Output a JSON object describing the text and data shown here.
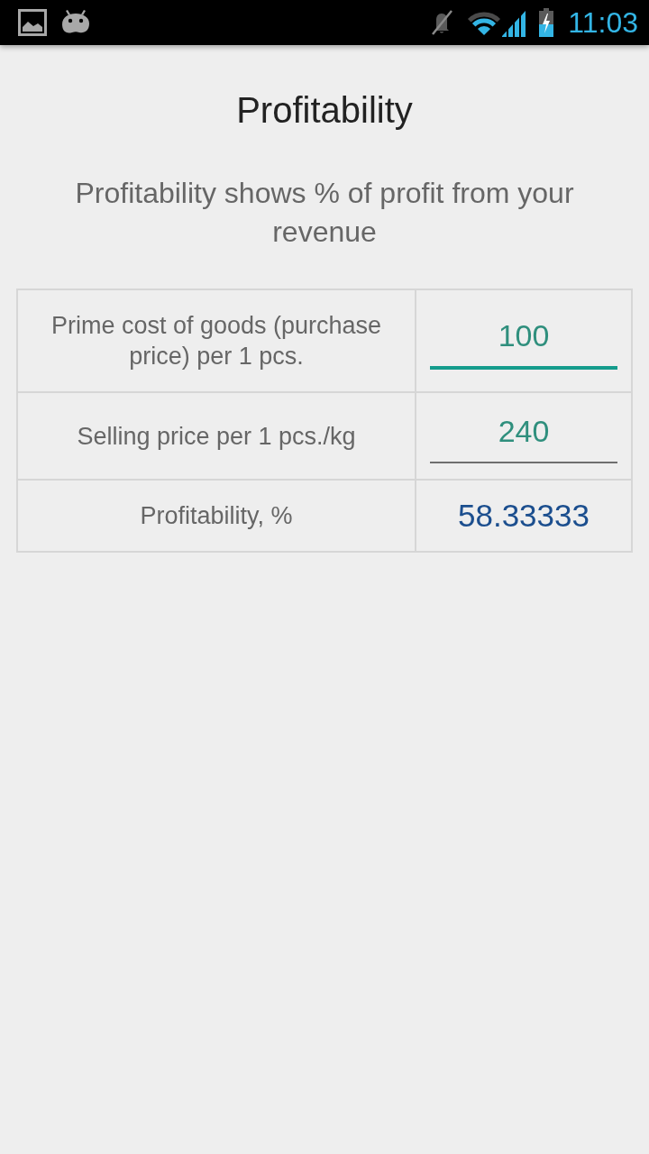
{
  "status_bar": {
    "time": "11:03"
  },
  "title": "Profitability",
  "subtitle": "Profitability shows % of profit from your revenue",
  "table": {
    "rows": [
      {
        "kind": "input",
        "label": "Prime cost of goods (purchase price) per 1 pcs.",
        "value": "100",
        "focused": true
      },
      {
        "kind": "input",
        "label": "Selling price per 1 pcs./kg",
        "value": "240",
        "focused": false
      },
      {
        "kind": "result",
        "label": "Profitability, %",
        "value": "58.33333"
      }
    ]
  }
}
